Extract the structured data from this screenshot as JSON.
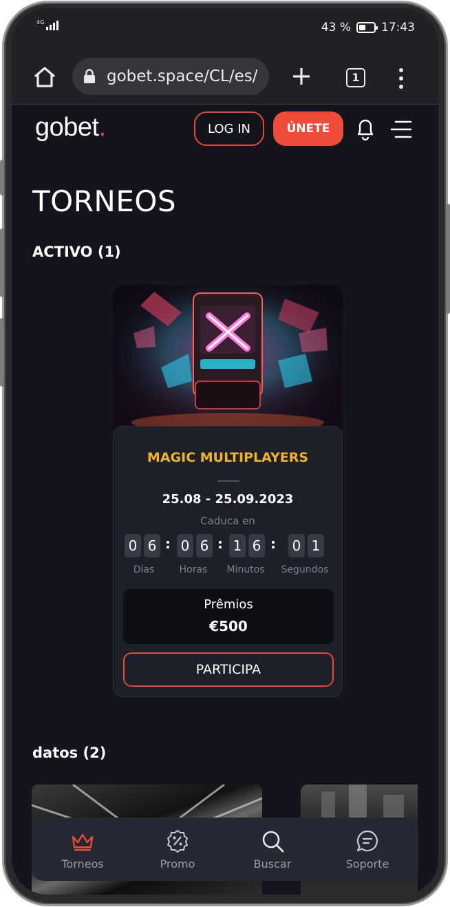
{
  "status_bar": {
    "network": "4G",
    "battery": "43 %",
    "time": "17:43"
  },
  "browser": {
    "url": "gobet.space/CL/es/",
    "tab_count": "1"
  },
  "header": {
    "logo_text": "gobet",
    "logo_dot": ".",
    "login_label": "LOG IN",
    "join_label": "ÚNETE"
  },
  "page": {
    "title": "TORNEOS",
    "active_section": "ACTIVO (1)",
    "data_section": "datos (2)"
  },
  "tournament": {
    "name": "MAGIC MULTIPLAYERS",
    "dates": "25.08 - 25.09.2023",
    "expires_label": "Caduca en",
    "countdown": {
      "days": [
        "0",
        "6"
      ],
      "hours": [
        "0",
        "6"
      ],
      "minutes": [
        "1",
        "6"
      ],
      "seconds": [
        "0",
        "1"
      ],
      "separator": ":"
    },
    "units": {
      "days": "Días",
      "hours": "Horas",
      "minutes": "Minutos",
      "seconds": "Segundos"
    },
    "prize_label": "Prêmios",
    "prize_amount": "€500",
    "cta_label": "PARTICIPA"
  },
  "bottom_nav": {
    "items": [
      {
        "label": "Torneos",
        "icon": "crown-icon",
        "active": true
      },
      {
        "label": "Promo",
        "icon": "percent-badge-icon"
      },
      {
        "label": "Buscar",
        "icon": "search-icon"
      },
      {
        "label": "Soporte",
        "icon": "chat-icon"
      }
    ]
  },
  "colors": {
    "accent": "#ef4b3b",
    "gold": "#f0b429",
    "background": "#14151c",
    "card": "#1e2029"
  }
}
